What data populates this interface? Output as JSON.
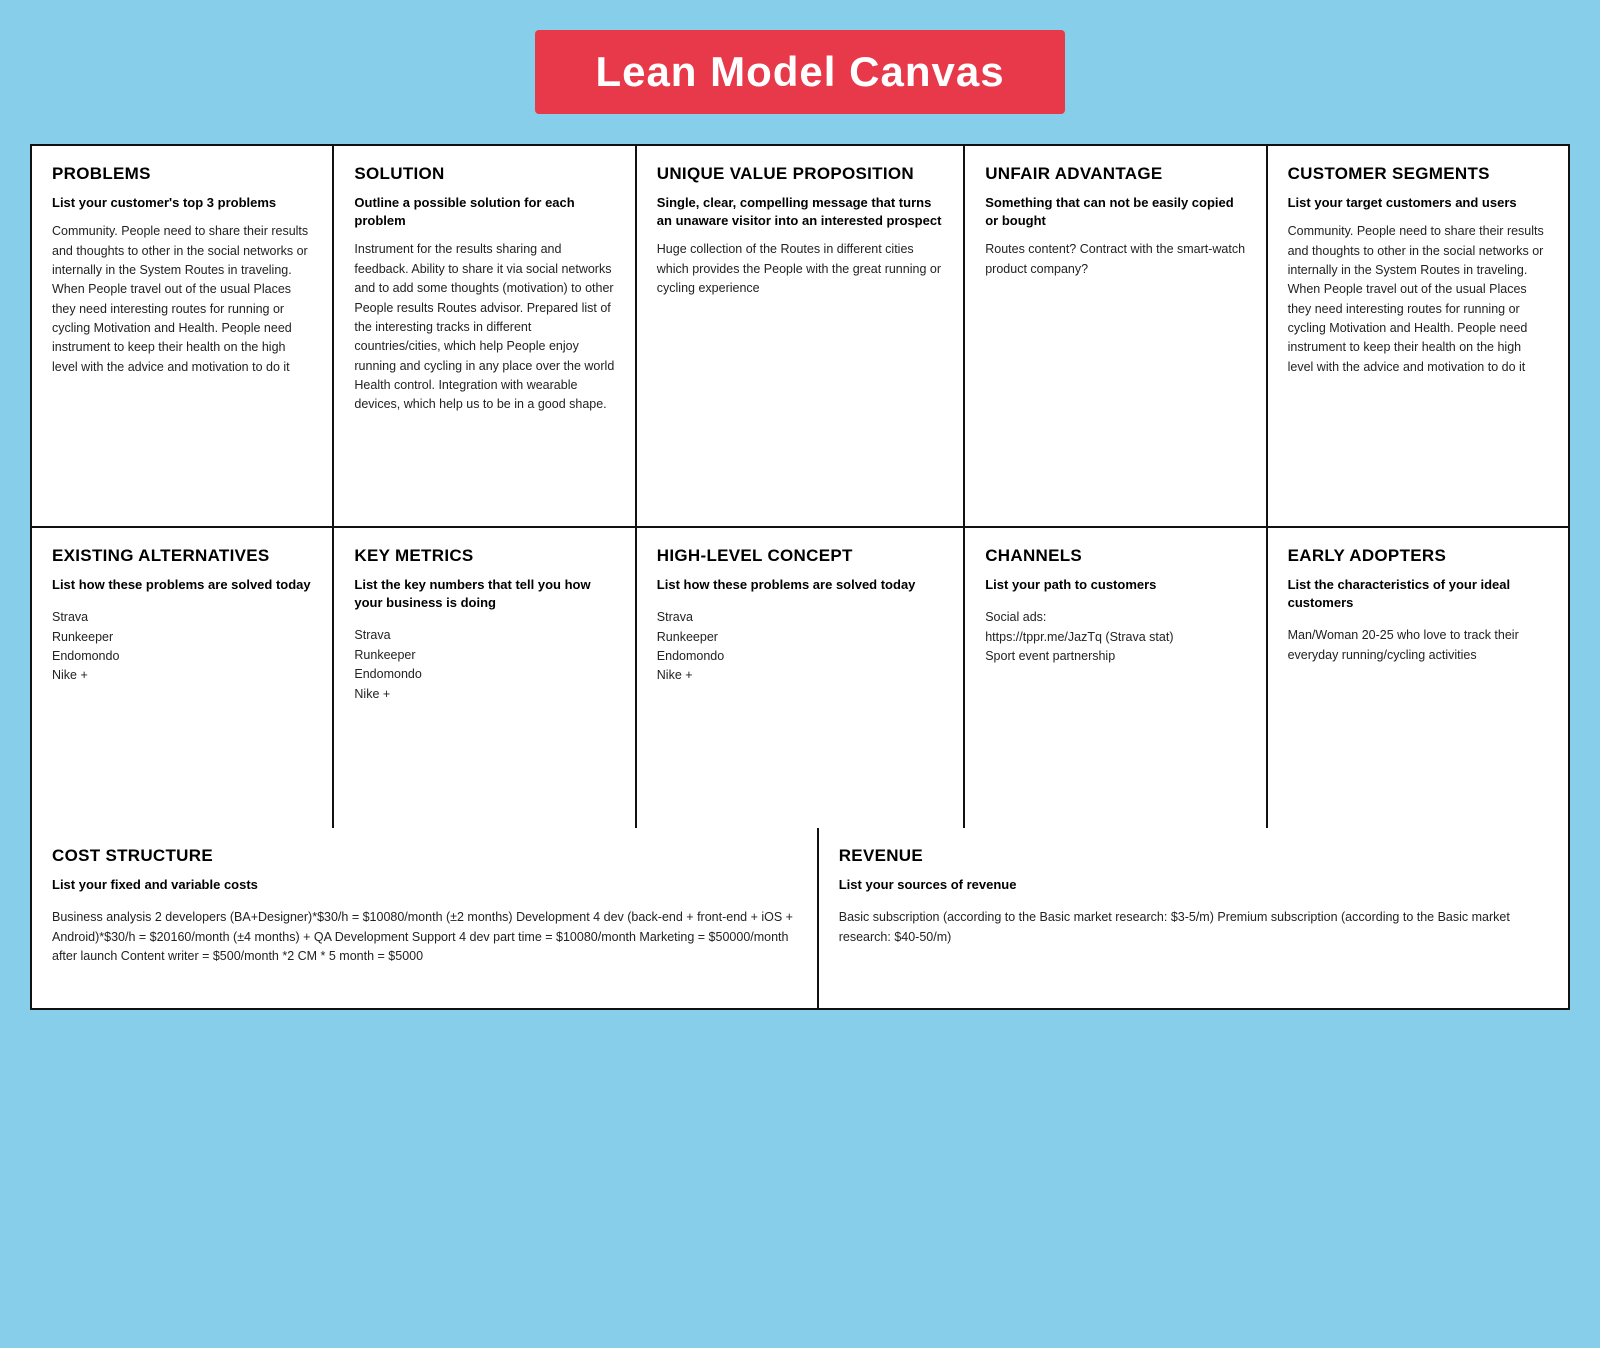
{
  "title": "Lean Model Canvas",
  "sections": {
    "problems": {
      "title": "PROBLEMS",
      "subtitle": "List your customer's top 3 problems",
      "body": "Community. People need to share their results and thoughts to other in the social networks or internally in the System Routes in traveling. When People travel out of the usual Places they need interesting routes for running or cycling Motivation and Health. People need instrument to keep their health on the high level with the advice and motivation to do it"
    },
    "solution": {
      "title": "SOLUTION",
      "subtitle": "Outline a possible solution for each problem",
      "body": "Instrument for the results sharing and feedback. Ability to share it via social networks and to add some thoughts (motivation) to other People results Routes advisor. Prepared list of the interesting tracks in different countries/cities, which help People enjoy running and cycling in any place over the world Health control. Integration with wearable devices, which help us to be in a good shape."
    },
    "uvp": {
      "title": "UNIQUE VALUE PROPOSITION",
      "subtitle": "Single, clear, compelling message that turns an unaware visitor into an interested prospect",
      "body": "Huge collection of the Routes in different cities which provides the People with the great running or cycling experience"
    },
    "unfair": {
      "title": "UNFAIR ADVANTAGE",
      "subtitle": "Something that can not be easily copied or bought",
      "body": "Routes content?  Contract with the smart-watch product company?"
    },
    "customer": {
      "title": "CUSTOMER SEGMENTS",
      "subtitle": "List your target customers and users",
      "body": "Community. People need to share their results and thoughts to other in the social networks or internally in the System Routes in traveling. When People travel out of the usual Places they need interesting routes for running or cycling Motivation and Health. People need instrument to keep their health on the high level with the advice and motivation to do it"
    },
    "existing": {
      "title": "EXISTING ALTERNATIVES",
      "subtitle": "List how these problems are solved today",
      "body": "Strava\nRunkeeper\nEndomondo\nNike +"
    },
    "metrics": {
      "title": "KEY METRICS",
      "subtitle": "List the key numbers that tell you how your business is doing",
      "body": "Strava\nRunkeeper\nEndomondo\nNike +"
    },
    "highlevel": {
      "title": "HIGH-LEVEL CONCEPT",
      "subtitle": "List how these problems are solved today",
      "body": "Strava\nRunkeeper\nEndomondo\nNike +"
    },
    "channels": {
      "title": "CHANNELS",
      "subtitle": "List your path to customers",
      "body": "Social ads:\nhttps://tppr.me/JazTq (Strava stat)\nSport event partnership"
    },
    "early": {
      "title": "EARLY ADOPTERS",
      "subtitle": "List the characteristics of your ideal customers",
      "body": "Man/Woman 20-25 who love to track their everyday running/cycling activities"
    },
    "cost": {
      "title": "COST STRUCTURE",
      "subtitle": "List your fixed and variable costs",
      "body": "Business analysis 2 developers (BA+Designer)*$30/h = $10080/month (±2 months) Development 4 dev (back-end + front-end + iOS + Android)*$30/h = $20160/month (±4 months) + QA Development Support 4 dev part time = $10080/month Marketing = $50000/month after launch  Content writer = $500/month *2 CM * 5 month = $5000"
    },
    "revenue": {
      "title": "REVENUE",
      "subtitle": "List your sources of revenue",
      "body": "Basic subscription (according to the Basic market research: $3-5/m) Premium subscription (according to the Basic market research: $40-50/m)"
    }
  }
}
